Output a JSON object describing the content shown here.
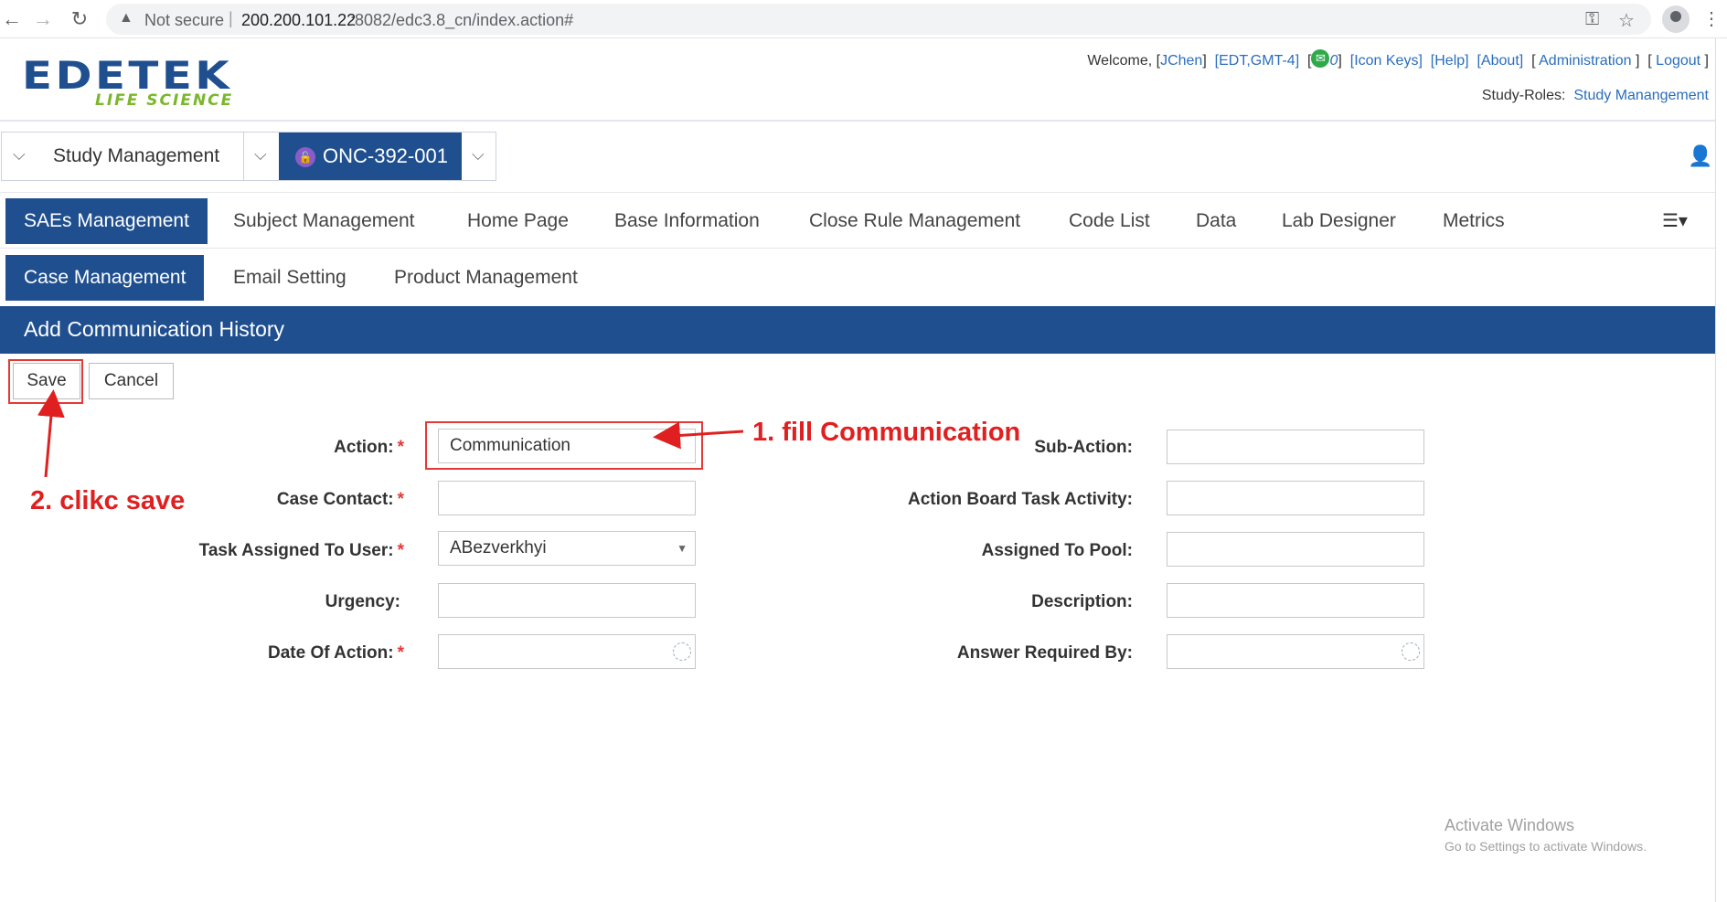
{
  "browser": {
    "not_secure": "Not secure",
    "url_host": "200.200.101.22",
    "url_path": ":8082/edc3.8_cn/index.action#"
  },
  "header": {
    "logo_main": "EDETEK",
    "logo_sub": "LIFE SCIENCE",
    "welcome": "Welcome,",
    "user": "JChen",
    "timezone": "EDT,GMT-4",
    "mail_count": "0",
    "links": [
      "Icon Keys",
      "Help",
      "About",
      "Administration",
      "Logout"
    ],
    "study_roles_label": "Study-Roles:",
    "study_roles_value": "Study Manangement"
  },
  "study_bar": {
    "module": "Study Management",
    "protocol": "ONC-392-001"
  },
  "nav": {
    "row1": [
      "SAEs Management",
      "Subject Management",
      "Home Page",
      "Base Information",
      "Close Rule Management",
      "Code List",
      "Data",
      "Lab Designer",
      "Metrics"
    ],
    "row2": [
      "Case Management",
      "Email Setting",
      "Product Management"
    ]
  },
  "page": {
    "title": "Add Communication History",
    "save_label": "Save",
    "cancel_label": "Cancel"
  },
  "form": {
    "left": [
      {
        "label": "Action:",
        "required": "*",
        "value": "Communication"
      },
      {
        "label": "Case Contact:",
        "required": "*",
        "value": ""
      },
      {
        "label": "Task Assigned To User:",
        "required": "*",
        "value": "ABezverkhyi"
      },
      {
        "label": "Urgency:",
        "required": "",
        "value": ""
      },
      {
        "label": "Date Of Action:",
        "required": "*",
        "value": ""
      }
    ],
    "right": [
      {
        "label": "Sub-Action:",
        "value": ""
      },
      {
        "label": "Action Board Task Activity:",
        "value": ""
      },
      {
        "label": "Assigned To Pool:",
        "value": ""
      },
      {
        "label": "Description:",
        "value": ""
      },
      {
        "label": "Answer Required By:",
        "value": ""
      }
    ]
  },
  "annotations": {
    "step1": "1. fill Communication",
    "step2": "2. clikc save"
  },
  "watermark": {
    "line1": "Activate Windows",
    "line2": "Go to Settings to activate Windows."
  },
  "colors": {
    "brand_blue": "#1f4f8f",
    "annotation_red": "#e02020",
    "link_blue": "#2a6ebb"
  }
}
